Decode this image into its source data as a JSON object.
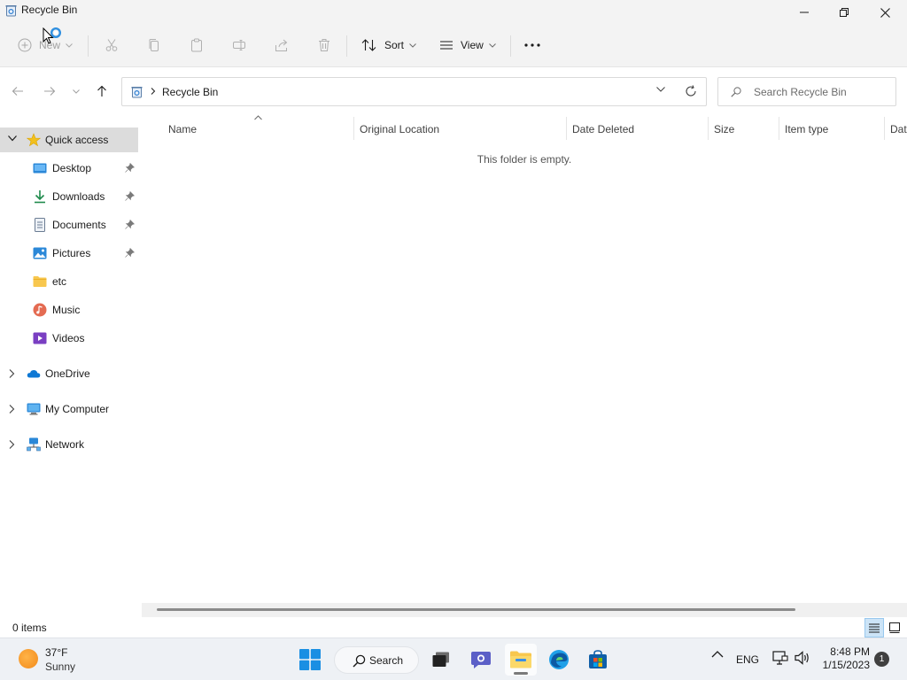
{
  "window": {
    "title": "Recycle Bin"
  },
  "commandbar": {
    "new_label": "New",
    "sort_label": "Sort",
    "view_label": "View"
  },
  "address": {
    "crumb": "Recycle Bin",
    "search_placeholder": "Search Recycle Bin"
  },
  "navpane": {
    "quick_access": "Quick access",
    "items": [
      {
        "label": "Desktop",
        "pinned": true
      },
      {
        "label": "Downloads",
        "pinned": true
      },
      {
        "label": "Documents",
        "pinned": true
      },
      {
        "label": "Pictures",
        "pinned": true
      },
      {
        "label": "etc",
        "pinned": false
      },
      {
        "label": "Music",
        "pinned": false
      },
      {
        "label": "Videos",
        "pinned": false
      }
    ],
    "onedrive": "OneDrive",
    "computer": "My Computer",
    "network": "Network"
  },
  "columns": [
    "Name",
    "Original Location",
    "Date Deleted",
    "Size",
    "Item type",
    "Dat"
  ],
  "content": {
    "empty_message": "This folder is empty."
  },
  "statusbar": {
    "count": "0 items"
  },
  "taskbar": {
    "weather_temp": "37°F",
    "weather_desc": "Sunny",
    "search_label": "Search",
    "language": "ENG",
    "time": "8:48 PM",
    "date": "1/15/2023",
    "notification_count": "1"
  },
  "colors": {
    "accent": "#0067c0",
    "selected_nav": "#dcdcdc",
    "folder_yellow": "#f8c74e",
    "onedrive_blue": "#0f78d4"
  }
}
